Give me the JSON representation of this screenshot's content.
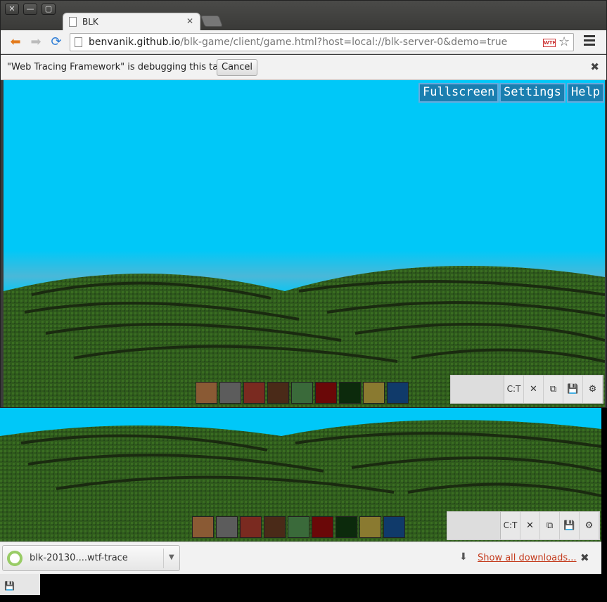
{
  "window": {
    "buttons": [
      "✕",
      "—",
      "▢"
    ]
  },
  "tab": {
    "title": "BLK",
    "close": "✕"
  },
  "toolbar": {
    "back_icon": "arrow-left-icon",
    "forward_icon": "arrow-right-icon",
    "reload_icon": "reload-icon",
    "url_host": "benvanik.github.io",
    "url_path": "/blk-game/client/game.html?host=local://blk-server-0&demo=true",
    "wtf_badge": "WTF",
    "star": "☆"
  },
  "infobar": {
    "message": "\"Web Tracing Framework\" is debugging this tab.",
    "cancel": "Cancel",
    "close": "✖"
  },
  "hud": {
    "fullscreen": "Fullscreen",
    "settings": "Settings",
    "help": "Help"
  },
  "palette": {
    "colors": [
      "#8a5a34",
      "#5c5c5c",
      "#7a2a20",
      "#4a2a18",
      "#3a6a3a",
      "#6a0808",
      "#0c2a0c",
      "#8a7a30",
      "#103a6a"
    ]
  },
  "wtf_toolbar": {
    "ct": "C:T",
    "close": "✕",
    "save": "💾",
    "settings": "⚙"
  },
  "downloads": {
    "file": "blk-20130....wtf-trace",
    "show_all": "Show all downloads...",
    "close": "✖"
  }
}
